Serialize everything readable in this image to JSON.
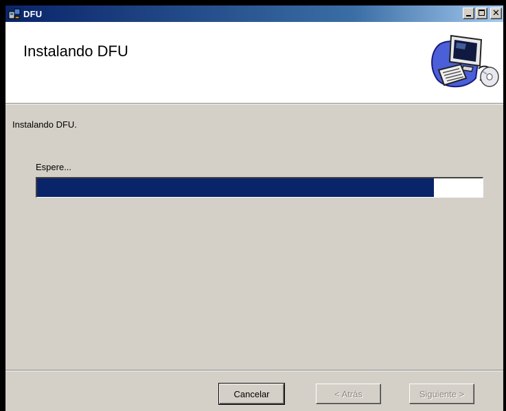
{
  "window": {
    "title": "DFU"
  },
  "header": {
    "title": "Instalando DFU"
  },
  "body": {
    "message": "Instalando DFU.",
    "wait_label": "Espere...",
    "progress_fraction": 0.89
  },
  "buttons": {
    "cancel_label": "Cancelar",
    "back_label": "< Atrás",
    "next_label": "Siguiente >"
  },
  "colors": {
    "progress_fill": "#0a246a",
    "title_bar": "#0a246a",
    "dialog_bg": "#d4d0c8"
  },
  "icons": {
    "app": "installer-icon",
    "banner": "computer-setup-graphic"
  }
}
